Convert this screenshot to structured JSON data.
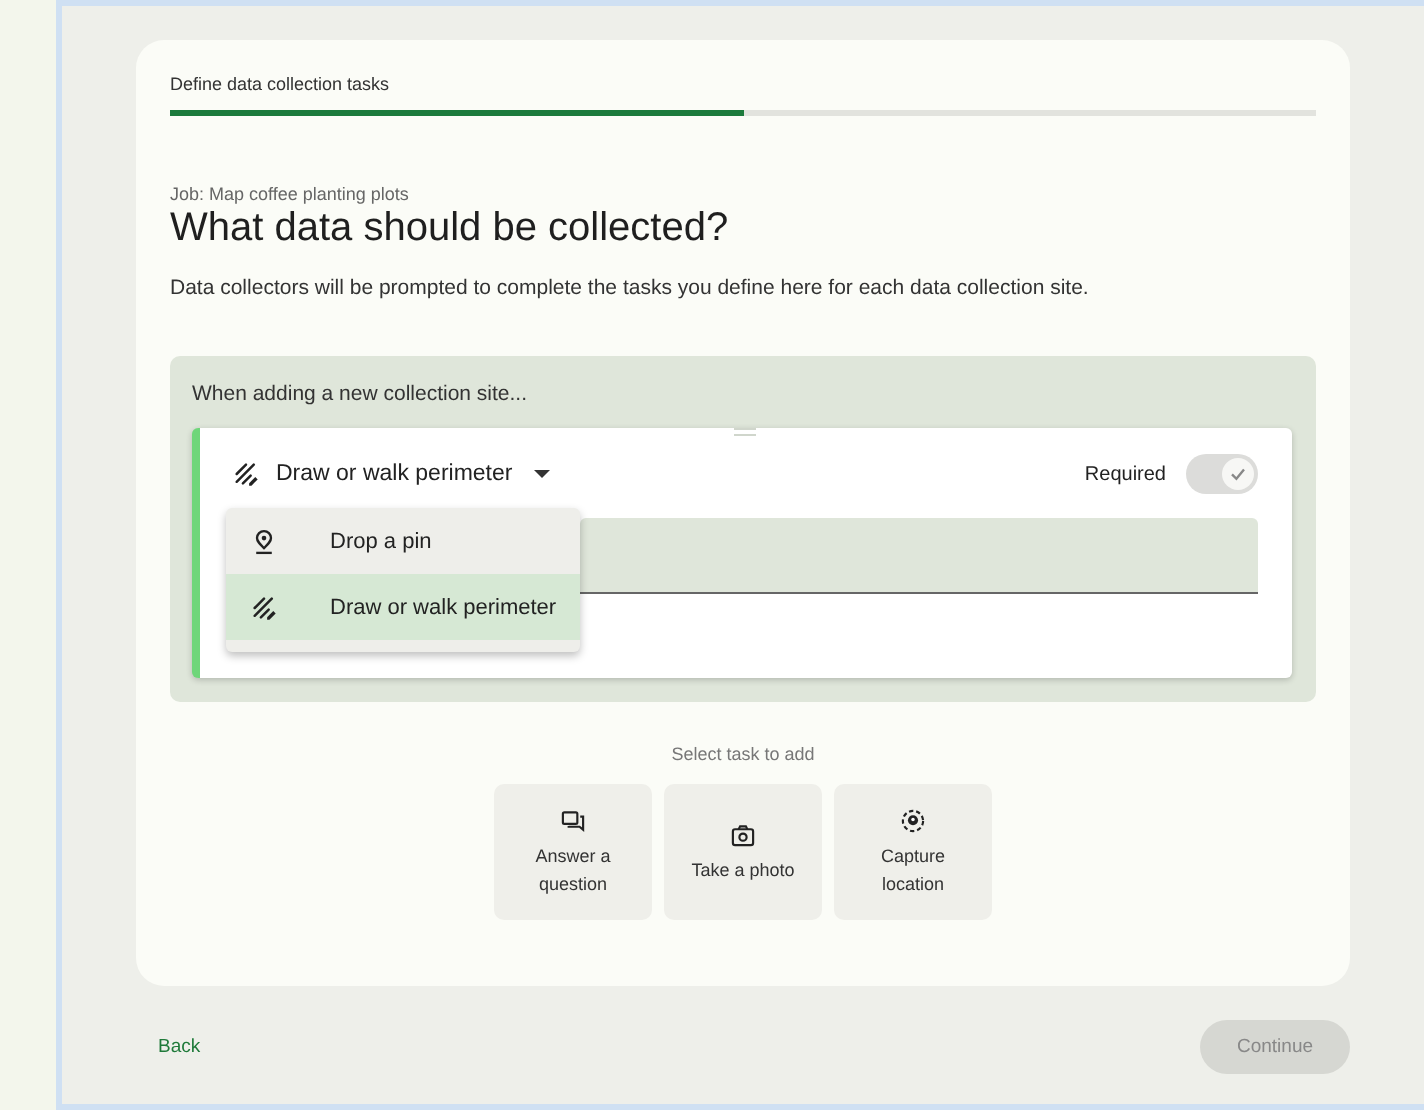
{
  "stepper": {
    "title": "Define data collection tasks",
    "level": 0.5
  },
  "job": "Job: Map coffee planting plots",
  "heading": "What data should be collected?",
  "description": "Data collectors will be prompted to complete the tasks you define here for each data collection site.",
  "panel": {
    "label": "When adding a new collection site...",
    "task": {
      "type_select": {
        "value": "Draw or walk perimeter",
        "kind": "perimeter",
        "expanded": true
      },
      "required": {
        "label": "Required",
        "on": true
      },
      "menu": [
        {
          "label": "Drop a pin",
          "kind": "pin",
          "selected": false
        },
        {
          "label": "Draw or walk perimeter",
          "kind": "perimeter",
          "selected": true
        }
      ]
    }
  },
  "add_tasks": {
    "label": "Select task to add",
    "options": [
      {
        "label": "Answer a question",
        "kind": "question"
      },
      {
        "label": "Take a photo",
        "kind": "photo"
      },
      {
        "label": "Capture location",
        "kind": "location"
      }
    ]
  },
  "footer": {
    "back": "Back",
    "continue": {
      "label": "Continue",
      "disabled": true
    }
  }
}
